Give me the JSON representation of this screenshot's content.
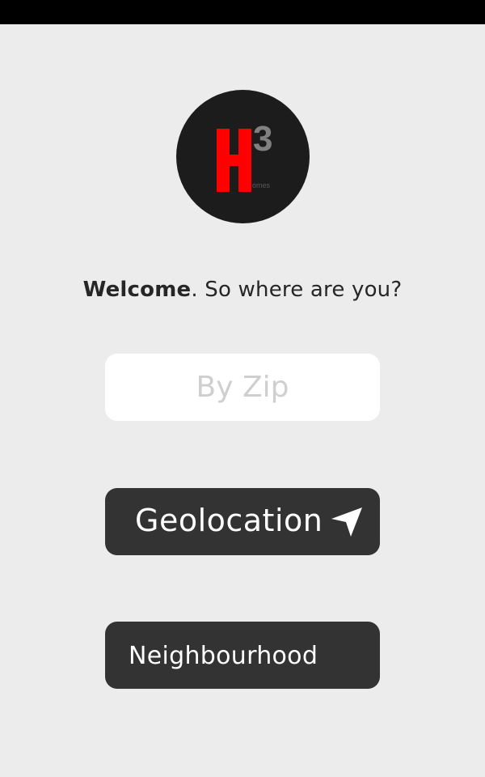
{
  "logo": {
    "letter": "H",
    "superscript": "3",
    "subtext": "omes",
    "colors": {
      "circle": "#1c1c1c",
      "letter": "#ff0000",
      "superscript": "#808080"
    }
  },
  "welcome": {
    "bold": "Welcome",
    "rest": ". So where are you?"
  },
  "zip": {
    "placeholder": "By Zip",
    "value": ""
  },
  "geolocation": {
    "label": "Geolocation",
    "icon": "navigation-arrow-icon"
  },
  "neighbourhood": {
    "label": "Neighbourhood"
  },
  "colors": {
    "background": "#ececec",
    "status_bar": "#000000",
    "button_dark": "#333333",
    "input_bg": "#ffffff"
  }
}
